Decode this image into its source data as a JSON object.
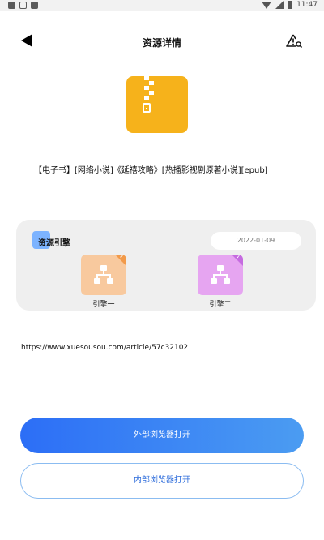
{
  "status_bar": {
    "time": "11:47"
  },
  "header": {
    "title": "资源详情"
  },
  "resource": {
    "icon": "zip-file-icon",
    "name": "【电子书】[网络小说]《延禧攻略》[热播影视剧原著小说][epub]",
    "url": "https://www.xuesousou.com/article/57c32102"
  },
  "engine_card": {
    "label": "资源引擎",
    "date": "2022-01-09",
    "engines": [
      {
        "label": "引擎一",
        "color": "#f8c99e",
        "selected": true
      },
      {
        "label": "引擎二",
        "color": "#e6a5f1",
        "selected": true
      }
    ]
  },
  "buttons": {
    "external": "外部浏览器打开",
    "internal": "内部浏览器打开"
  },
  "colors": {
    "accent": "#2c6ef6",
    "zip_icon": "#f6b21b"
  }
}
